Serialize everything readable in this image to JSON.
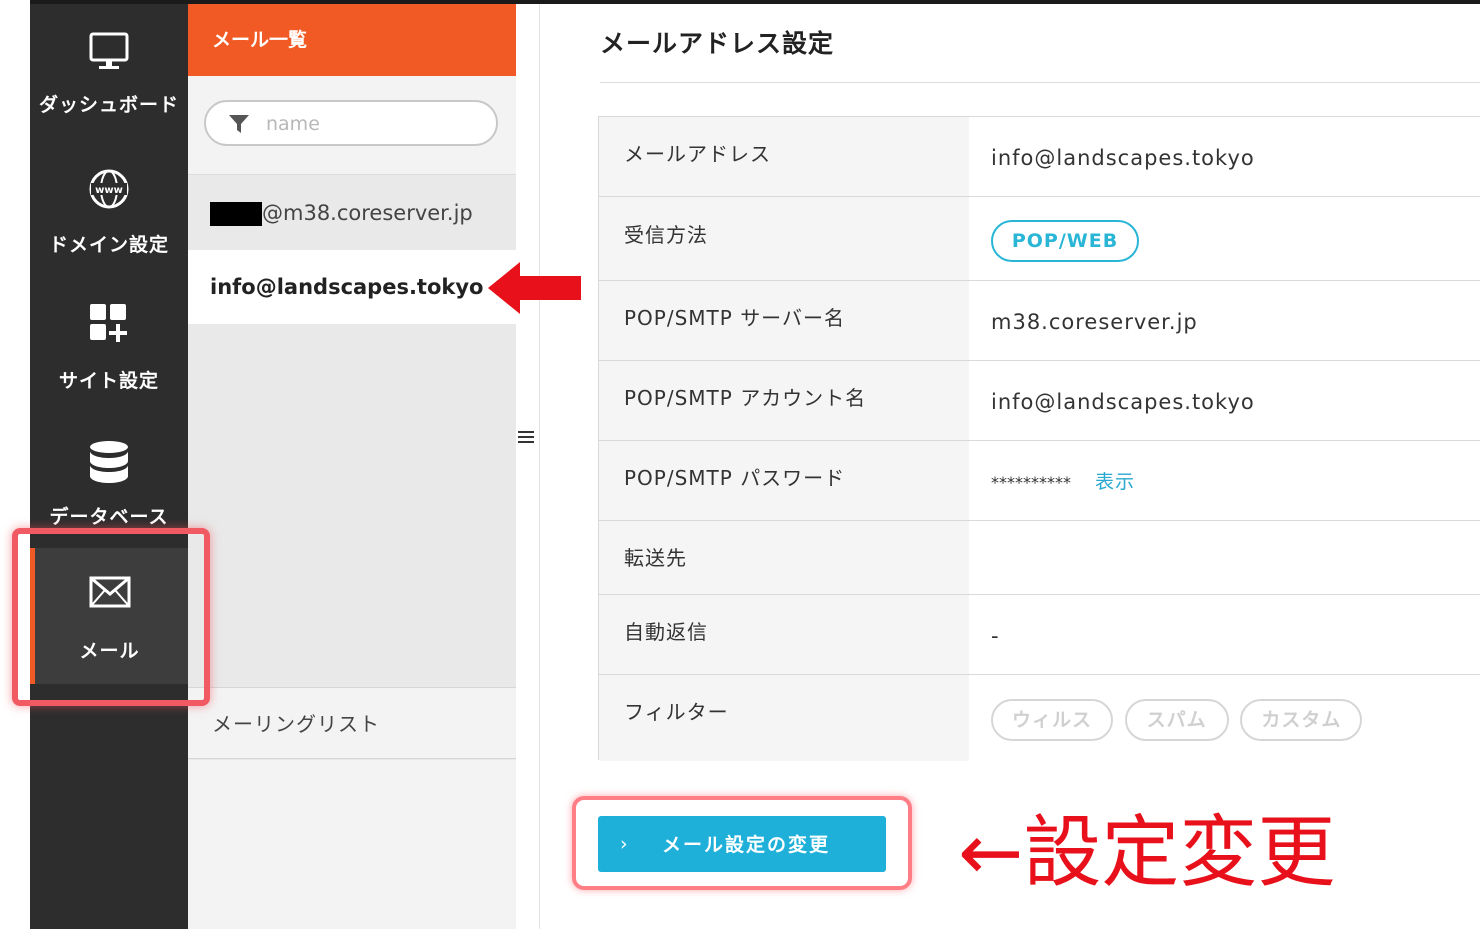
{
  "sidebar": {
    "items": [
      {
        "label": "ダッシュボード",
        "icon": "monitor-icon"
      },
      {
        "label": "ドメイン設定",
        "icon": "globe-www-icon"
      },
      {
        "label": "サイト設定",
        "icon": "grid-plus-icon"
      },
      {
        "label": "データベース",
        "icon": "database-icon"
      },
      {
        "label": "メール",
        "icon": "envelope-icon"
      }
    ],
    "active": "メール"
  },
  "mail_panel": {
    "header": "メール一覧",
    "filter_placeholder": "name",
    "accounts": [
      {
        "email_suffix": "@m38.coreserver.jp",
        "redacted_prefix": true
      },
      {
        "email": "info@landscapes.tokyo",
        "selected": true
      }
    ],
    "mailing_list_label": "メーリングリスト"
  },
  "main": {
    "title": "メールアドレス設定",
    "rows": [
      {
        "key": "メールアドレス",
        "value": "info@landscapes.tokyo"
      },
      {
        "key": "受信方法",
        "value": "POP/WEB"
      },
      {
        "key": "POP/SMTP サーバー名",
        "value": "m38.coreserver.jp"
      },
      {
        "key": "POP/SMTP アカウント名",
        "value": "info@landscapes.tokyo"
      },
      {
        "key": "POP/SMTP パスワード",
        "value": "**********",
        "link": "表示"
      },
      {
        "key": "転送先",
        "value": ""
      },
      {
        "key": "自動返信",
        "value": "-"
      },
      {
        "key": "フィルター",
        "tags": [
          "ウィルス",
          "スパム",
          "カスタム"
        ]
      }
    ],
    "change_button": {
      "chevron": "›",
      "label": "メール設定の変更"
    }
  },
  "annotation": "←設定変更",
  "colors": {
    "accent_orange": "#f15a24",
    "accent_cyan": "#1fb0da",
    "highlight_red": "#e8101a"
  }
}
